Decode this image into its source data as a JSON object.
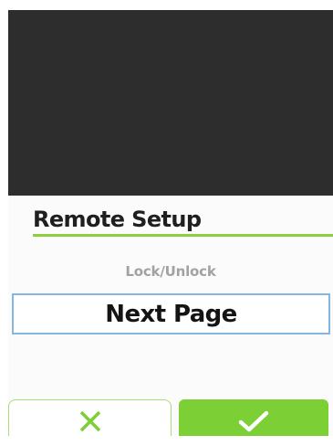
{
  "screen": {
    "title": "Remote Setup",
    "subtitle": "Lock/Unlock",
    "selected_option": "Next Page"
  },
  "buttons": {
    "cancel_icon": "close-icon",
    "confirm_icon": "checkmark-icon"
  },
  "colors": {
    "top_panel": "#2d2d2d",
    "accent_green": "#7ccf34",
    "underline_green": "#8ccf3f",
    "selection_border_blue": "#85b6e0",
    "subtitle_gray": "#a2a2a2"
  }
}
